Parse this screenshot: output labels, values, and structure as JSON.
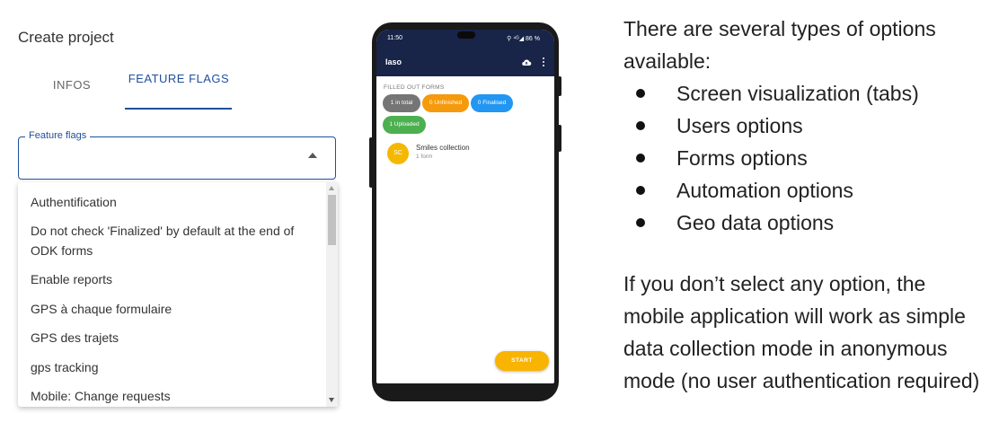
{
  "left": {
    "title": "Create project",
    "tabs": [
      {
        "label": "INFOS"
      },
      {
        "label": "FEATURE FLAGS"
      }
    ],
    "select_label": "Feature flags",
    "options": [
      "Authentification",
      "Do not check 'Finalized' by default at the end of ODK forms",
      "Enable reports",
      "GPS à chaque formulaire",
      "GPS des trajets",
      "gps tracking",
      "Mobile: Change requests"
    ]
  },
  "phone": {
    "status_time": "11:50",
    "status_right": "⚲ ⁴ᴳ◢ 86 %",
    "app_title": "Iaso",
    "section_label": "FILLED OUT FORMS",
    "chips": {
      "total": "1 in total",
      "unfinished": "0 Unfinished",
      "finalised": "0 Finalised",
      "uploaded": "1 Uploaded"
    },
    "form_item": {
      "avatar": "SC",
      "title": "Smiles collection",
      "subtitle": "1 form"
    },
    "start_label": "START",
    "colors": {
      "appbar": "#182448",
      "unfinished": "#f59a0c",
      "finalised": "#2196f3",
      "uploaded": "#4caf50",
      "accent": "#f8b400"
    }
  },
  "right": {
    "intro": "There are several types of options available:",
    "bullets": [
      "Screen visualization (tabs)",
      "Users options",
      "Forms options",
      "Automation options",
      "Geo data options"
    ],
    "outro": "If you don’t select any option, the mobile application will work as simple data collection mode in anonymous mode (no user authentication required)"
  }
}
